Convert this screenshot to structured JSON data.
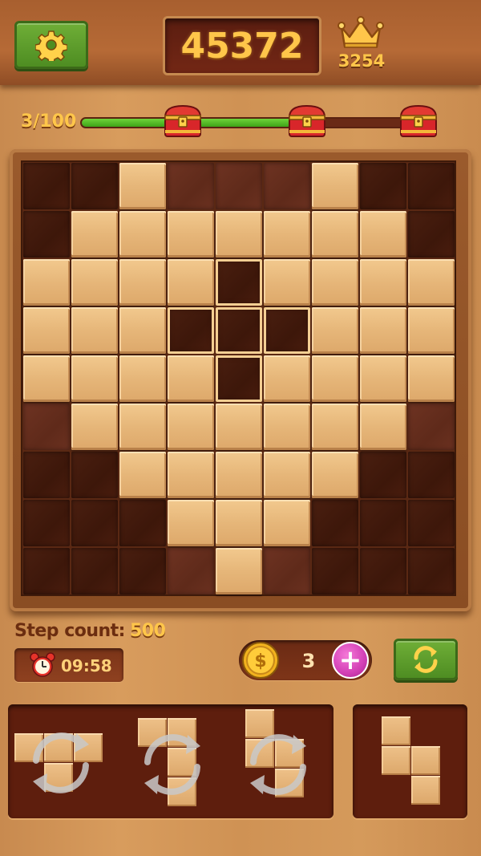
{
  "header": {
    "score": "45372",
    "best_score": "3254"
  },
  "progress": {
    "level_label": "3/100",
    "fraction": 0.6,
    "milestones": [
      {
        "name": "chest-icon",
        "state": "reached"
      },
      {
        "name": "chest-icon",
        "state": "locked"
      },
      {
        "name": "chest-icon",
        "state": "locked"
      }
    ]
  },
  "board": {
    "size": 9,
    "legend": {
      "B": "block",
      "D": "empty-dark",
      "L": "empty-light",
      "H": "hint"
    },
    "rows": [
      "DDBLLLBDD",
      "DBBBBBBBD",
      "BBBBHBBBB",
      "BBBHHHBBB",
      "BBBBHBBBB",
      "LBBBBBBBL",
      "DDBBBBBDD",
      "DDDBBBDDD",
      "DDDLBLDDD"
    ]
  },
  "stats": {
    "step_label": "Step count:",
    "step_value": "500",
    "timer": "09:58"
  },
  "coins": {
    "count": "3",
    "plus_label": "+"
  },
  "colors": {
    "accent_gold": "#ffc64a",
    "button_green": "#4e8d22",
    "plus_pink": "#d23fb5",
    "progress_green": "#3ea318"
  },
  "icons": {
    "settings": "gear-icon",
    "best": "crown-icon",
    "timer": "alarm-clock-icon",
    "coin": "dollar-coin-icon",
    "refresh": "refresh-icon",
    "rotate": "rotate-icon"
  }
}
